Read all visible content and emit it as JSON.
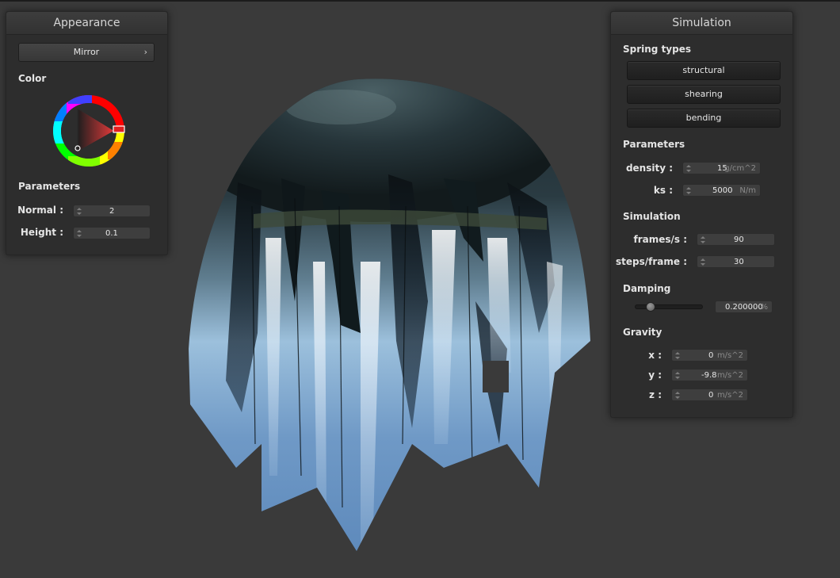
{
  "appearance": {
    "title": "Appearance",
    "mode_value": "Mirror",
    "color_label": "Color",
    "parameters_label": "Parameters",
    "normal_label": "Normal :",
    "normal_value": "2",
    "height_label": "Height :",
    "height_value": "0.1"
  },
  "simulation": {
    "title": "Simulation",
    "spring_types_label": "Spring types",
    "springs": [
      "structural",
      "shearing",
      "bending"
    ],
    "parameters_label": "Parameters",
    "density_label": "density :",
    "density_value": "15",
    "density_unit": "g/cm^2",
    "ks_label": "ks :",
    "ks_value": "5000",
    "ks_unit": "N/m",
    "simulation_label": "Simulation",
    "fps_label": "frames/s :",
    "fps_value": "90",
    "steps_label": "steps/frame :",
    "steps_value": "30",
    "damping_label": "Damping",
    "damping_value": "0.200000",
    "damping_unit": "%",
    "damping_level": 0.2,
    "gravity_label": "Gravity",
    "gx_label": "x :",
    "gx_value": "0",
    "gy_label": "y :",
    "gy_value": "-9.8",
    "gz_label": "z :",
    "gz_value": "0",
    "g_unit": "m/s^2"
  },
  "colors": {
    "background": "#3a3a3a",
    "panel": "#2d2d2d",
    "picked_hue": "#e02020"
  }
}
